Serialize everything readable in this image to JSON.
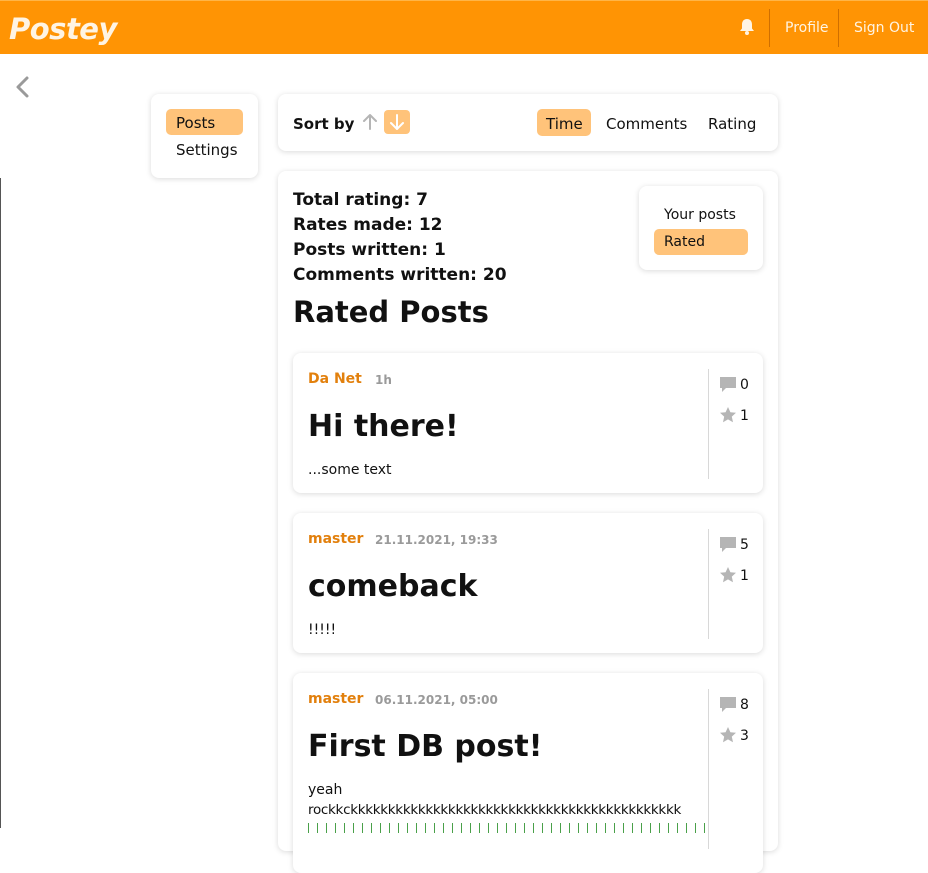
{
  "app": {
    "logo": "Postey"
  },
  "header": {
    "profile_label": "Profile",
    "signout_label": "Sign Out",
    "bell_icon": "bell-icon",
    "brand_color": "#ff9404"
  },
  "sidenav": {
    "items": [
      {
        "label": "Posts",
        "active": true
      },
      {
        "label": "Settings",
        "active": false
      }
    ]
  },
  "sort": {
    "label": "Sort by",
    "direction": "descending",
    "options": [
      {
        "label": "Time",
        "active": true
      },
      {
        "label": "Comments",
        "active": false
      },
      {
        "label": "Rating",
        "active": false
      }
    ]
  },
  "stats": {
    "total_rating": "Total rating: 7",
    "rates_made": "Rates made: 12",
    "posts_written": "Posts written: 1",
    "comments_written": "Comments written: 20"
  },
  "filter": {
    "items": [
      {
        "label": "Your posts",
        "active": false
      },
      {
        "label": "Rated",
        "active": true
      }
    ]
  },
  "section_title": "Rated Posts",
  "posts": [
    {
      "author": "Da Net",
      "time": "1h",
      "title": "Hi there!",
      "body": "...some text",
      "comments": "0",
      "rating": "1"
    },
    {
      "author": "master",
      "time": "21.11.2021, 19:33",
      "title": "comeback",
      "body": "!!!!!",
      "comments": "5",
      "rating": "1"
    },
    {
      "author": "master",
      "time": "06.11.2021, 05:00",
      "title": "First DB post!",
      "body": "yeah",
      "body2": "rockkckkkkkkkkkkkkkkkkkkkkkkkkkkkkkkkkkkkkkkkkkkkk",
      "comments": "8",
      "rating": "3"
    }
  ]
}
